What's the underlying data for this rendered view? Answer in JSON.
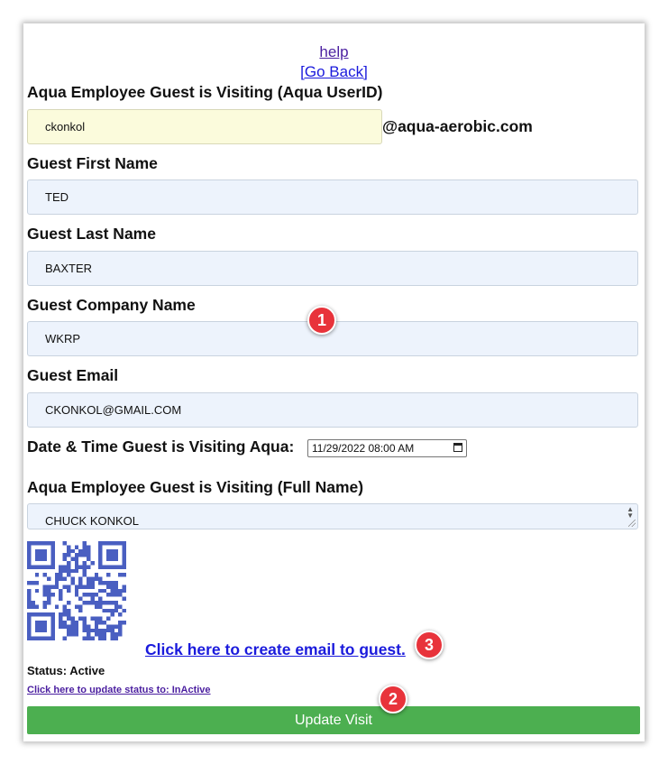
{
  "links": {
    "help": "help",
    "go_back": "[Go Back]"
  },
  "form": {
    "employee_userid": {
      "label": "Aqua Employee Guest is Visiting (Aqua UserID)",
      "value": "ckonkol",
      "suffix": "@aqua-aerobic.com"
    },
    "first_name": {
      "label": "Guest First Name",
      "value": "TED"
    },
    "last_name": {
      "label": "Guest Last Name",
      "value": "BAXTER"
    },
    "company": {
      "label": "Guest Company Name",
      "value": "WKRP"
    },
    "email": {
      "label": "Guest Email",
      "value": "CKONKOL@GMAIL.COM"
    },
    "visit_datetime": {
      "label": "Date & Time Guest is Visiting Aqua:",
      "value": "11/29/2022 08:00 AM"
    },
    "employee_fullname": {
      "label": "Aqua Employee Guest is Visiting (Full Name)",
      "value": "CHUCK KONKOL"
    }
  },
  "email_link": "Click here to create email to guest.",
  "status": {
    "text": "Status: Active",
    "update_link": "Click here to update status to: InActive"
  },
  "update_button": "Update Visit",
  "badges": {
    "one": "1",
    "two": "2",
    "three": "3"
  },
  "colors": {
    "button": "#4caf50",
    "badge": "#e8333b",
    "link": "#1a1adc",
    "visited_link": "#4b1fa0",
    "input_bg": "#edf3fc",
    "userid_bg": "#fbfbdc",
    "qr": "#4a5fc1"
  },
  "icons": {
    "cursor": "mouse-pointer-icon",
    "calendar": "calendar-icon",
    "qr": "qr-code-icon"
  }
}
